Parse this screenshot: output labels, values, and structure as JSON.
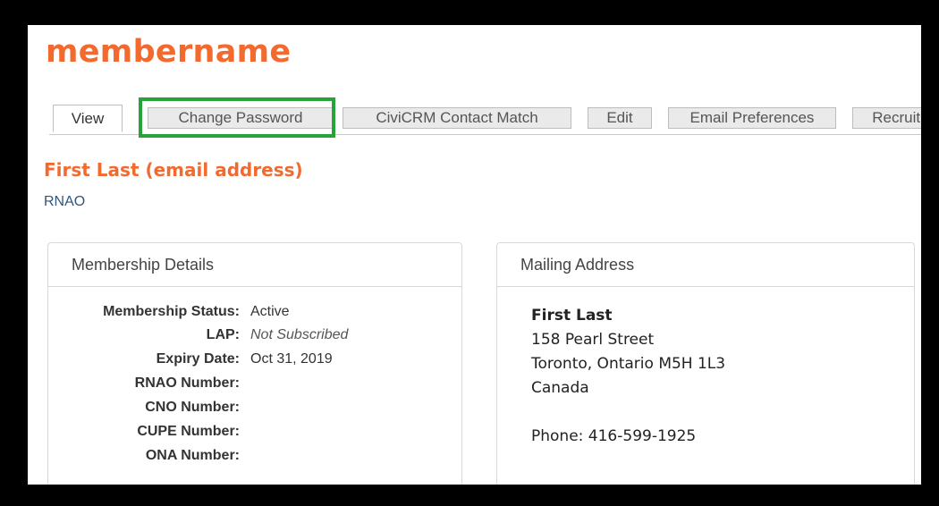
{
  "site": {
    "title": "membername"
  },
  "tabs": [
    {
      "label": "View",
      "active": true
    },
    {
      "label": "Change Password",
      "highlighted": true
    },
    {
      "label": "CiviCRM Contact Match"
    },
    {
      "label": "Edit"
    },
    {
      "label": "Email Preferences"
    },
    {
      "label": "Recruitme"
    }
  ],
  "highlight_color": "#27a33a",
  "accent_color": "#f26a2e",
  "contact": {
    "name": "First Last (email address)",
    "organization": "RNAO"
  },
  "membership": {
    "heading": "Membership Details",
    "rows": [
      {
        "label": "Membership Status:",
        "value": "Active"
      },
      {
        "label": "LAP:",
        "value": "Not Subscribed"
      },
      {
        "label": "Expiry Date:",
        "value": "Oct 31, 2019"
      },
      {
        "label": "RNAO Number:",
        "value": ""
      },
      {
        "label": "CNO Number:",
        "value": ""
      },
      {
        "label": "CUPE Number:",
        "value": ""
      },
      {
        "label": "ONA Number:",
        "value": ""
      }
    ]
  },
  "mailing": {
    "heading": "Mailing Address",
    "name": "First Last",
    "street": "158 Pearl Street",
    "city_line": "Toronto, Ontario M5H 1L3",
    "country": "Canada",
    "phone": "Phone: 416-599-1925"
  }
}
